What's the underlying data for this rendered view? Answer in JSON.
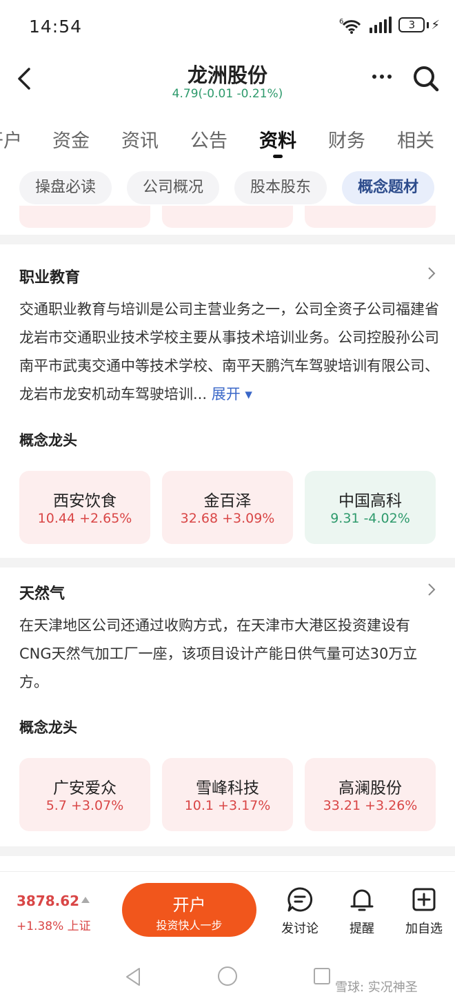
{
  "status_bar": {
    "time": "14:54",
    "battery": "3"
  },
  "header": {
    "title": "龙洲股份",
    "subtitle": "4.79(-0.01 -0.21%)"
  },
  "tabs": [
    {
      "label": "开户"
    },
    {
      "label": "资金"
    },
    {
      "label": "资讯"
    },
    {
      "label": "公告"
    },
    {
      "label": "资料",
      "active": true
    },
    {
      "label": "财务"
    },
    {
      "label": "相关"
    }
  ],
  "chips": [
    {
      "label": "操盘必读"
    },
    {
      "label": "公司概况"
    },
    {
      "label": "股本股东"
    },
    {
      "label": "概念题材",
      "active": true
    }
  ],
  "sections": [
    {
      "title": "职业教育",
      "description": "交通职业教育与培训是公司主营业务之一，公司全资子公司福建省龙岩市交通职业技术学校主要从事技术培训业务。公司控股孙公司南平市武夷交通中等技术学校、南平天鹏汽车驾驶培训有限公司、龙岩市龙安机动车驾驶培训...",
      "expand_label": "展开",
      "leaders_title": "概念龙头",
      "leaders": [
        {
          "name": "西安饮食",
          "value": "10.44 +2.65%",
          "trend": "up"
        },
        {
          "name": "金百泽",
          "value": "32.68 +3.09%",
          "trend": "up"
        },
        {
          "name": "中国高科",
          "value": "9.31 -4.02%",
          "trend": "down"
        }
      ]
    },
    {
      "title": "天然气",
      "description": "在天津地区公司还通过收购方式，在天津市大港区投资建设有CNG天然气加工厂一座，该项目设计产能日供气量可达30万立方。",
      "leaders_title": "概念龙头",
      "leaders": [
        {
          "name": "广安爱众",
          "value": "5.7 +3.07%",
          "trend": "up"
        },
        {
          "name": "雪峰科技",
          "value": "10.1 +3.17%",
          "trend": "up"
        },
        {
          "name": "高澜股份",
          "value": "33.21 +3.26%",
          "trend": "up"
        }
      ]
    }
  ],
  "bottom_bar": {
    "index_value": "3878.62",
    "index_change": "+1.38% 上证",
    "open_account": "开户",
    "open_account_sub": "投资快人一步",
    "discuss": "发讨论",
    "remind": "提醒",
    "add_watchlist": "加自选"
  },
  "watermark": "雪球: 实况神圣",
  "colors": {
    "up": "#d94646",
    "down": "#2e9a6c",
    "accent": "#f1561c",
    "link": "#3a67c8"
  }
}
